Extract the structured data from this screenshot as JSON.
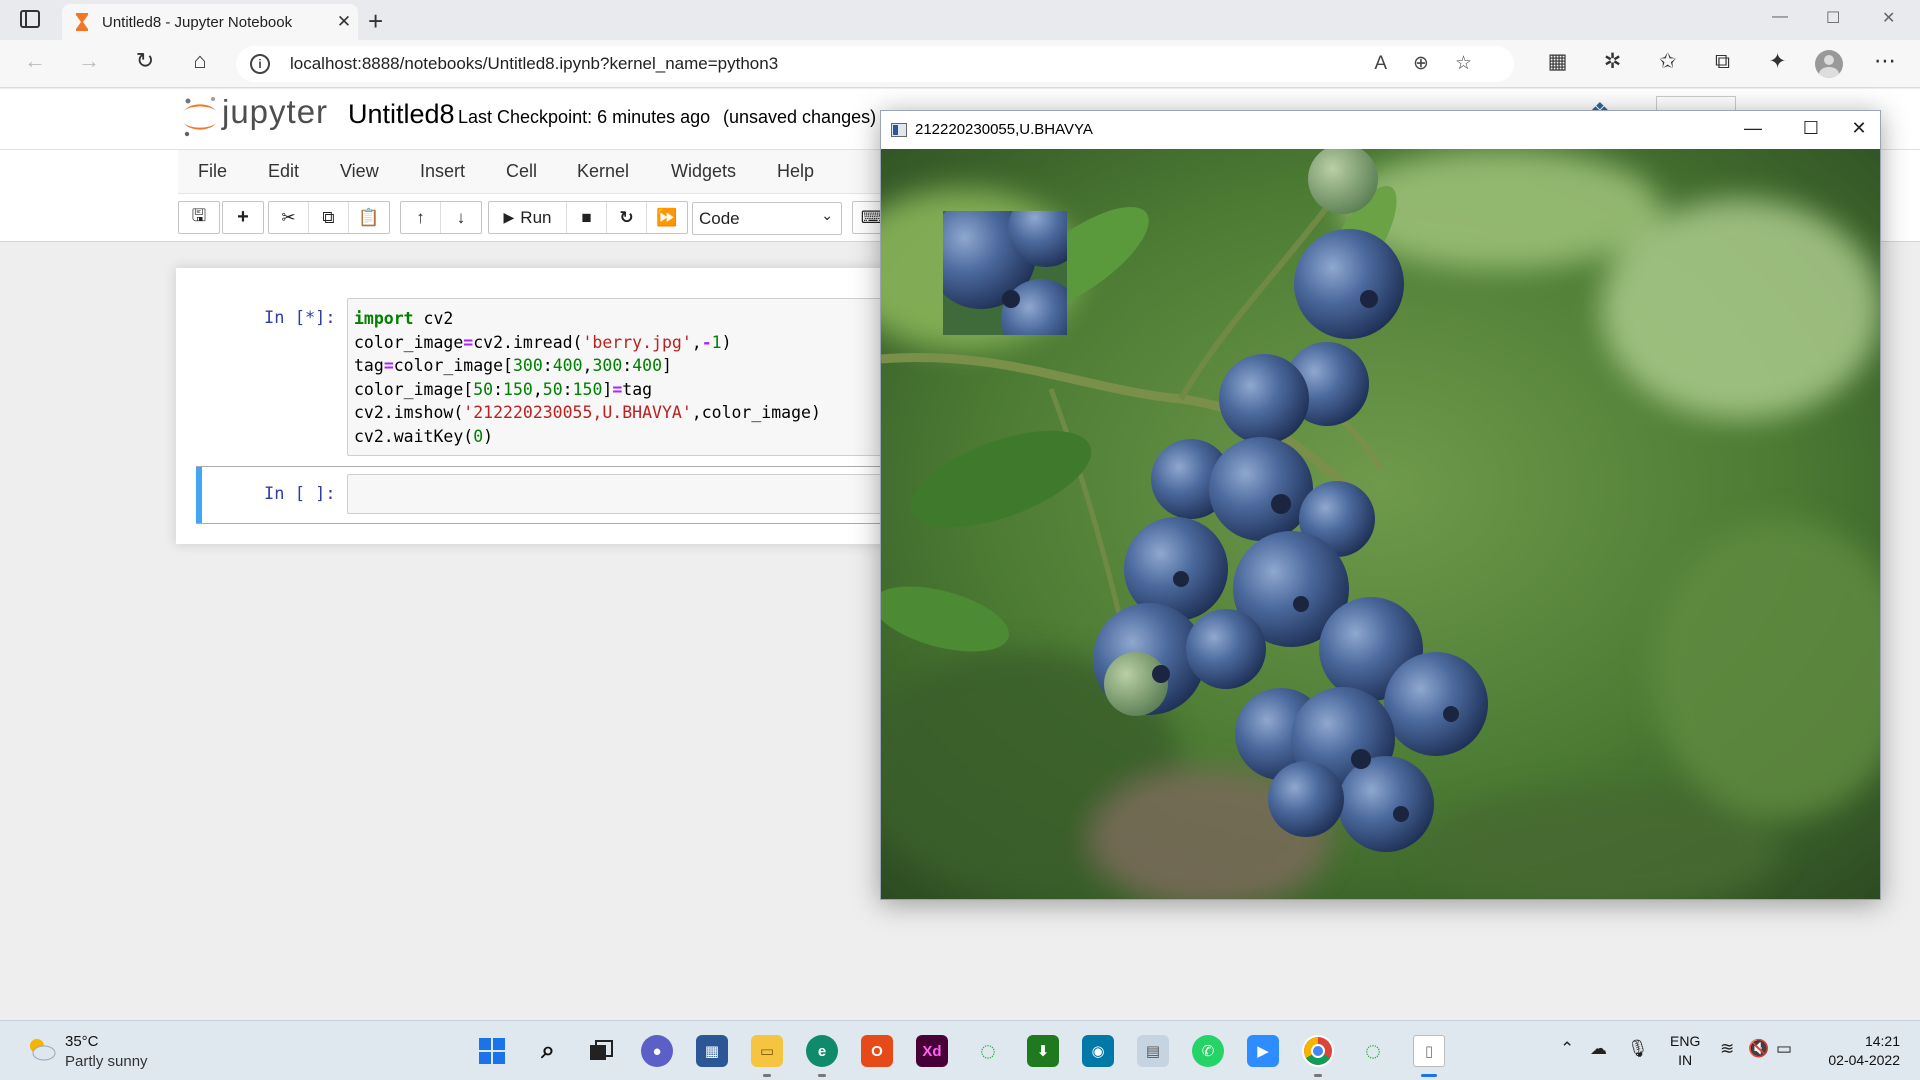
{
  "browser": {
    "tab_title": "Untitled8 - Jupyter Notebook",
    "tab_close": "✕",
    "new_tab": "+",
    "url": "localhost:8888/notebooks/Untitled8.ipynb?kernel_name=python3",
    "window_controls": {
      "minimize": "—",
      "maximize": "☐",
      "close": "✕"
    }
  },
  "jupyter": {
    "logo_text": "jupyter",
    "notebook_name": "Untitled8",
    "checkpoint": "Last Checkpoint: 6 minutes ago",
    "unsaved": "(unsaved changes)",
    "menu": [
      "File",
      "Edit",
      "View",
      "Insert",
      "Cell",
      "Kernel",
      "Widgets",
      "Help"
    ],
    "run_label": "Run",
    "cell_type": "Code",
    "cells": [
      {
        "prompt": "In [*]:",
        "code_lines": [
          "import cv2",
          "color_image=cv2.imread('berry.jpg',-1)",
          "tag=color_image[300:400,300:400]",
          "color_image[50:150,50:150]=tag",
          "cv2.imshow('212220230055,U.BHAVYA',color_image)",
          "cv2.waitKey(0)"
        ]
      },
      {
        "prompt": "In [ ]:",
        "code_lines": []
      }
    ]
  },
  "cv_window": {
    "title": "212220230055,U.BHAVYA",
    "controls": {
      "minimize": "—",
      "maximize": "☐",
      "close": "✕"
    }
  },
  "taskbar": {
    "weather_temp": "35°C",
    "weather_desc": "Partly sunny",
    "lang_line1": "ENG",
    "lang_line2": "IN",
    "time": "14:21",
    "date": "02-04-2022"
  },
  "colors": {
    "jupyter_orange": "#f37626",
    "prompt_blue": "#303f9f",
    "selected_cell": "#42a5f5",
    "berry_blue": "#3b5a8c",
    "foliage_green": "#4f7d3a"
  }
}
